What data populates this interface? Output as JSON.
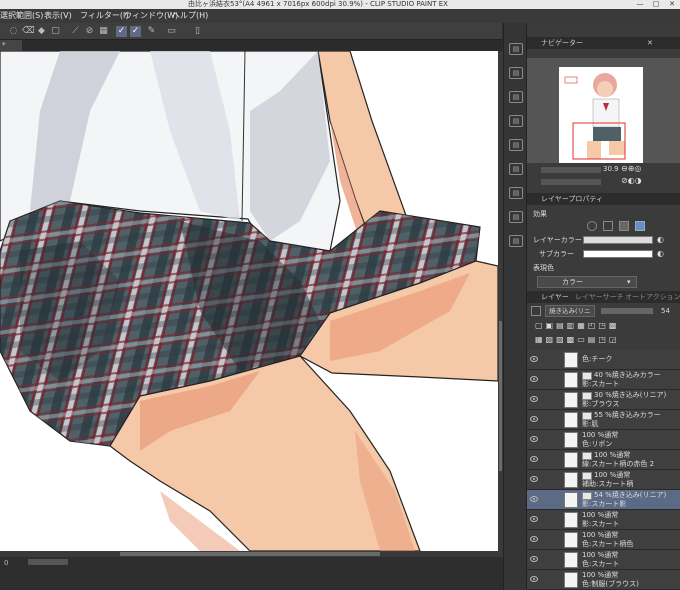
{
  "app": {
    "window_title": "由比ヶ浜結衣53°(A4 4961 x 7016px 600dpi 30.9%) - CLIP STUDIO PAINT EX",
    "win_buttons": [
      "—",
      "□",
      "✕"
    ]
  },
  "menu": [
    "選択範囲(S)",
    "表示(V)",
    "フィルター(I)",
    "ウィンドウ(W)",
    "ヘルプ(H)"
  ],
  "doc_tab": {
    "label": "*"
  },
  "status": {
    "zoom": "0",
    "position": "0.0"
  },
  "navigator": {
    "tab_label": "ナビゲーター",
    "zoom_value": "30.9"
  },
  "layer_property": {
    "tab_label": "レイヤープロパティ",
    "effect_label": "効果",
    "layer_color_label": "レイヤーカラー",
    "sub_color_label": "サブカラー",
    "expression_label": "表現色",
    "expression_value": "カラー"
  },
  "layer_panel": {
    "tabs": [
      "レイヤー",
      "レイヤーサーチ",
      "オートアクション"
    ],
    "blend_mode": "焼き込み(リニア)",
    "opacity": "54"
  },
  "layers": [
    {
      "line1": "",
      "line2": "色:チーク",
      "icon": false,
      "selected": false
    },
    {
      "line1": "40 %焼き込みカラー",
      "line2": "影:スカート",
      "icon": true,
      "selected": false
    },
    {
      "line1": "30 %焼き込み(リニア)",
      "line2": "影:ブラウス",
      "icon": true,
      "selected": false
    },
    {
      "line1": "55 %焼き込みカラー",
      "line2": "影:肌",
      "icon": true,
      "selected": false
    },
    {
      "line1": "100 %通常",
      "line2": "色:リボン",
      "icon": false,
      "selected": false
    },
    {
      "line1": "100 %通常",
      "line2": "線:スカート柄の赤色 2",
      "icon": true,
      "selected": false
    },
    {
      "line1": "100 %通常",
      "line2": "補助:スカート柄",
      "icon": true,
      "selected": false
    },
    {
      "line1": "54 %焼き込み(リニア)",
      "line2": "影:スカート影",
      "icon": true,
      "selected": true
    },
    {
      "line1": "100 %通常",
      "line2": "影:スカート",
      "icon": false,
      "selected": false
    },
    {
      "line1": "100 %通常",
      "line2": "色:スカート柄色",
      "icon": false,
      "selected": false
    },
    {
      "line1": "100 %通常",
      "line2": "色:スカート",
      "icon": false,
      "selected": false
    },
    {
      "line1": "100 %通常",
      "line2": "色:制服(ブラウス)",
      "icon": false,
      "selected": false
    }
  ],
  "colors": {
    "skin": "#f5c8a8",
    "skin_shadow": "#eba07f",
    "blouse": "#f4f5f7",
    "blouse_shadow": "#c6c9d2",
    "skirt": "#4f6066",
    "skirt_dark": "#2c3a40",
    "stripe_red": "#7c2630",
    "stripe_white": "#c8c4cc",
    "selection": "#5b6a85"
  }
}
